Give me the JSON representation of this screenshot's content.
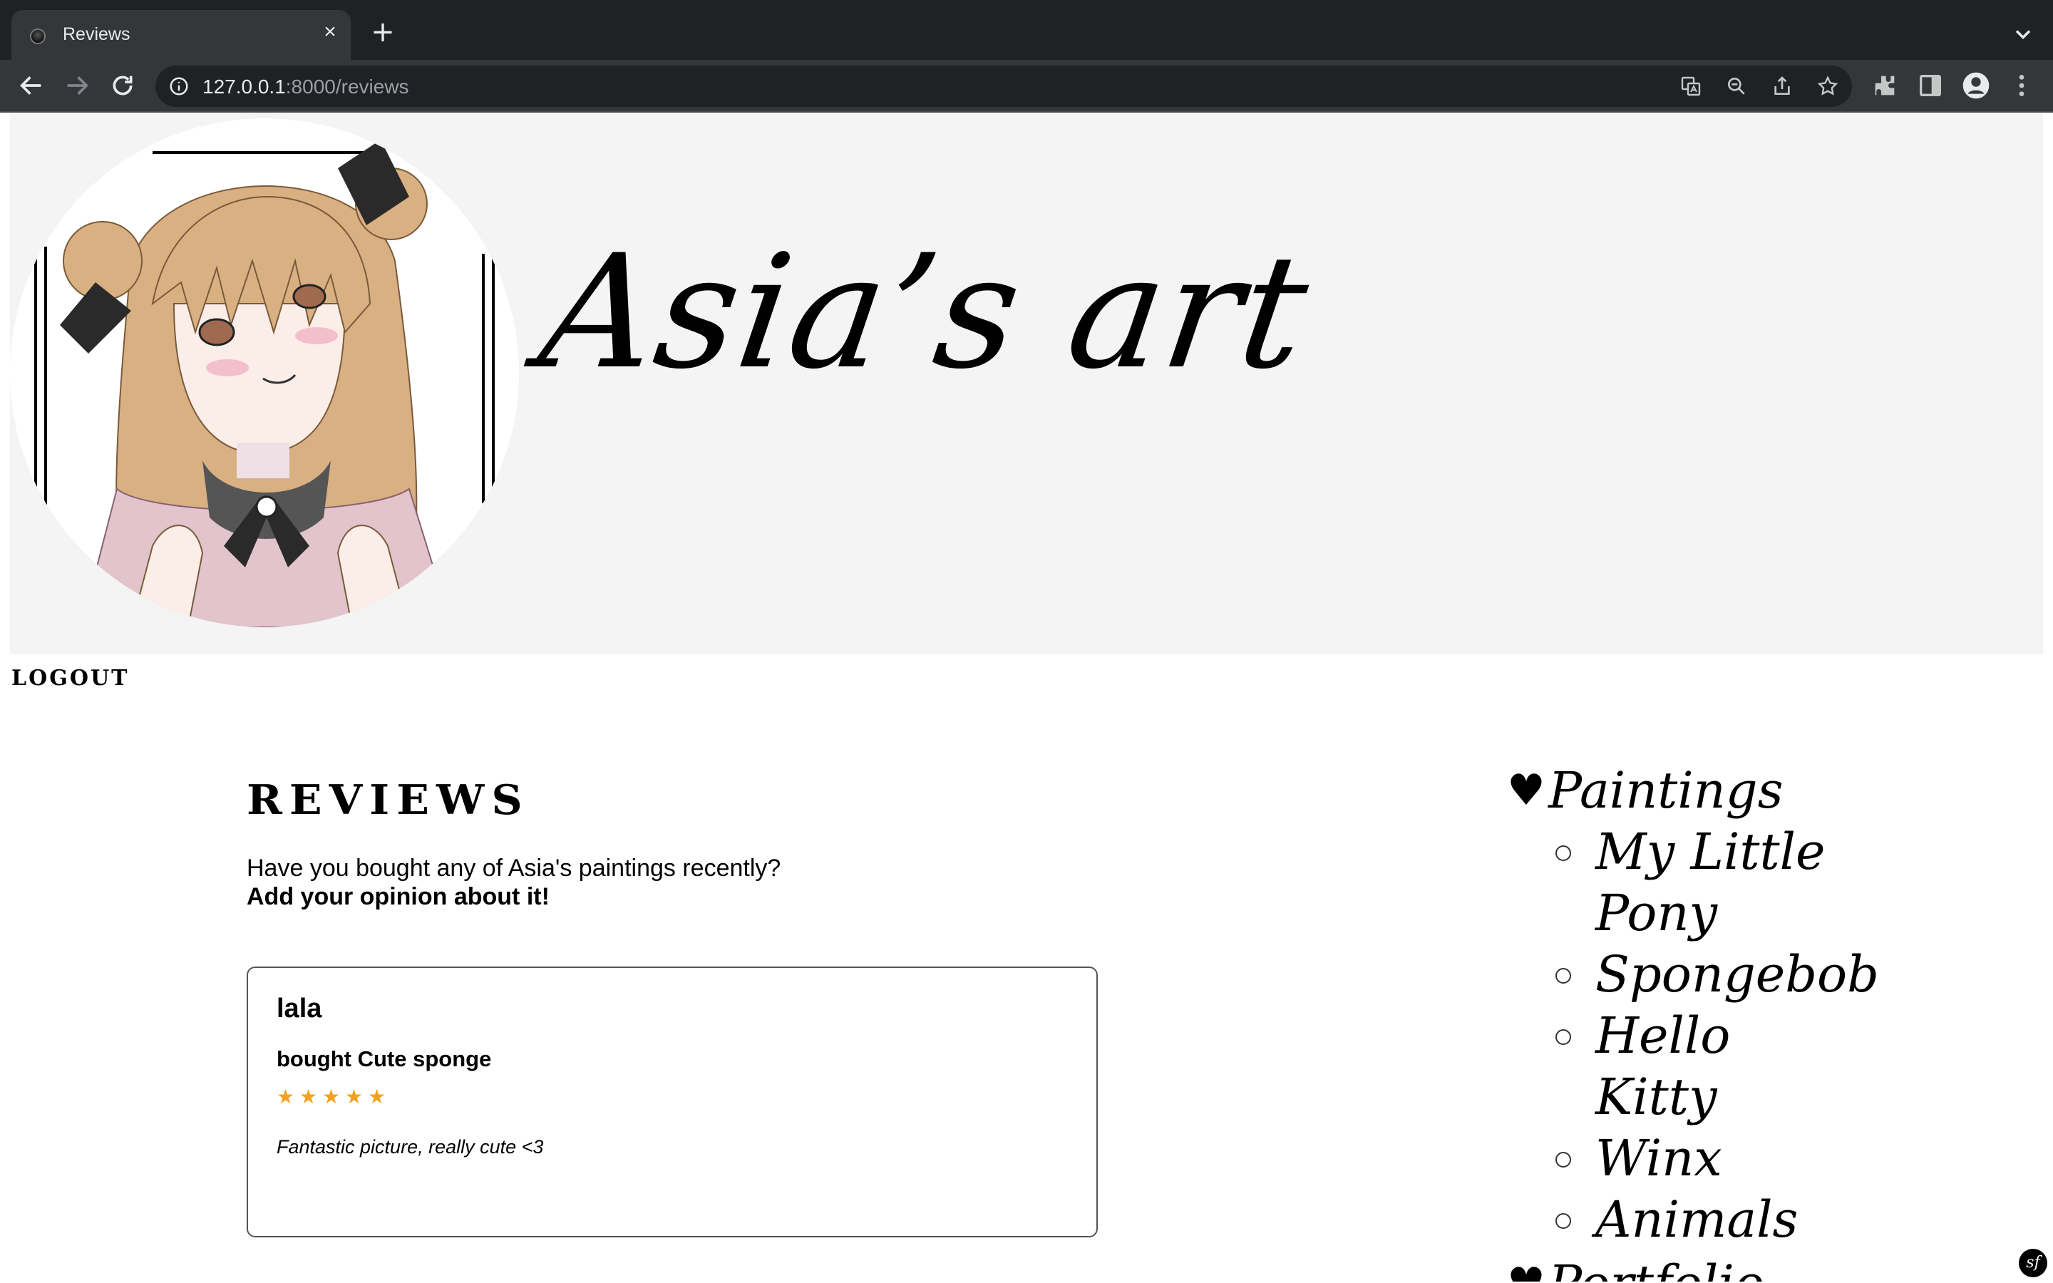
{
  "browser": {
    "tab_title": "Reviews",
    "url_host": "127.0.0.1",
    "url_rest": ":8000/reviews"
  },
  "header": {
    "site_title": "Asia’s art"
  },
  "nav": {
    "logout_label": "LOGOUT"
  },
  "main": {
    "heading": "REVIEWS",
    "intro_line": "Have you bought any of Asia's paintings recently?",
    "intro_cta": "Add your opinion about it!"
  },
  "reviews": [
    {
      "user": "lala",
      "bought": "bought Cute sponge",
      "rating": 5,
      "comment": "Fantastic picture, really cute <3"
    }
  ],
  "sidebar": {
    "categories": [
      {
        "label": "Paintings",
        "items": [
          "My Little Pony",
          "Spongebob",
          "Hello Kitty",
          "Winx",
          "Animals"
        ]
      },
      {
        "label": "Portfolio"
      }
    ]
  },
  "colors": {
    "star": "#f4a020",
    "header_bg": "#f4f4f4",
    "chrome_bg": "#202124"
  }
}
